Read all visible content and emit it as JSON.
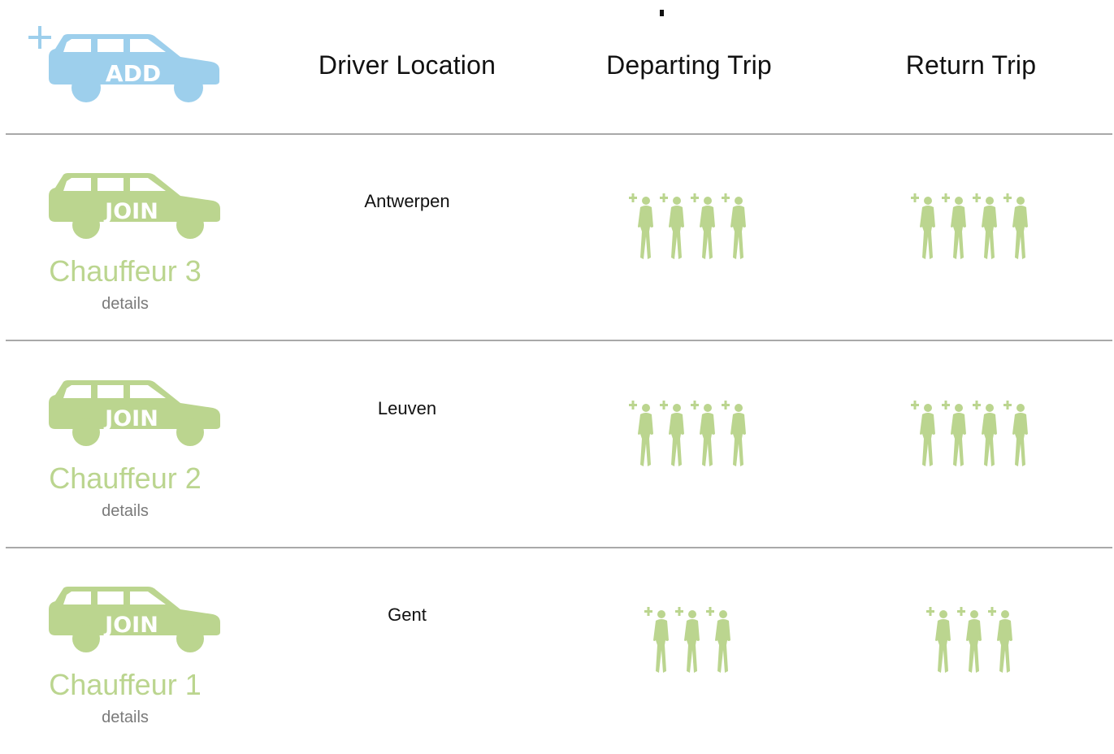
{
  "header": {
    "add_button_label": "ADD",
    "columns": {
      "driver_location": "Driver Location",
      "departing_trip": "Departing Trip",
      "return_trip": "Return Trip"
    }
  },
  "colors": {
    "add_car": "#9dcfec",
    "join_car": "#bbd58f",
    "passenger": "#bbd58f",
    "name_text": "#bbd58f",
    "details_text": "#7a7a7a",
    "divider": "#a9a9a9"
  },
  "icons": {
    "add": "car-add-icon",
    "join": "car-join-icon",
    "seat": "person-plus-icon"
  },
  "rows": [
    {
      "join_label": "JOIN",
      "name": "Chauffeur 3",
      "details": "details",
      "location": "Antwerpen",
      "departing_seats": 4,
      "return_seats": 4
    },
    {
      "join_label": "JOIN",
      "name": "Chauffeur 2",
      "details": "details",
      "location": "Leuven",
      "departing_seats": 4,
      "return_seats": 4
    },
    {
      "join_label": "JOIN",
      "name": "Chauffeur 1",
      "details": "details",
      "location": "Gent",
      "departing_seats": 3,
      "return_seats": 3
    }
  ]
}
